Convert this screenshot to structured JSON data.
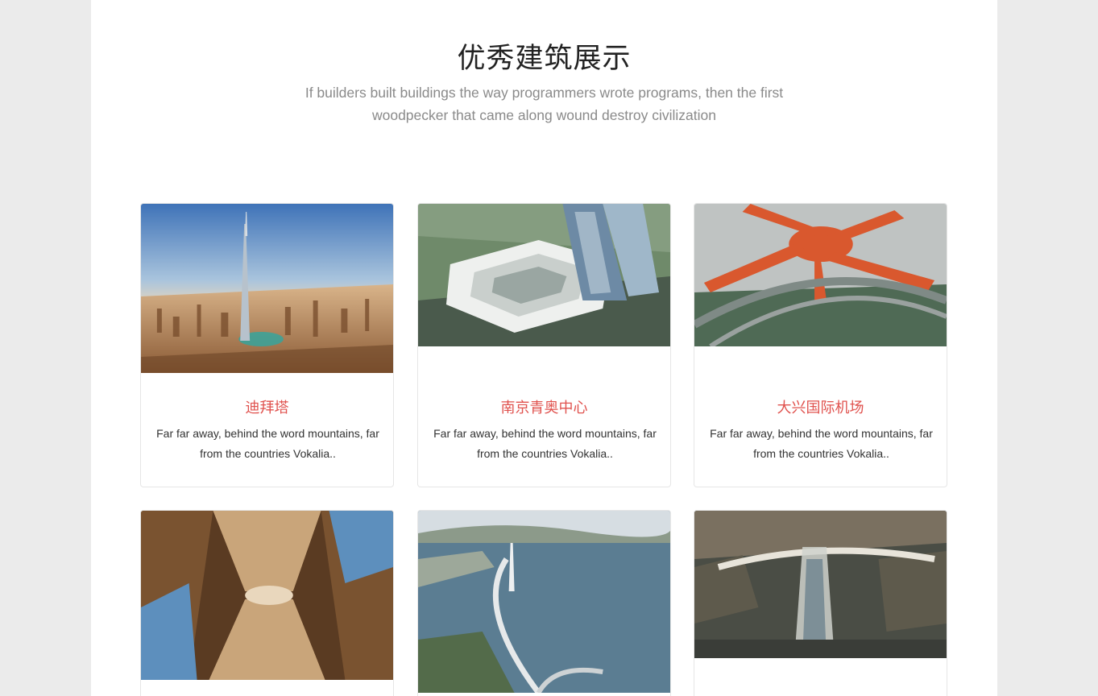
{
  "section": {
    "title": "优秀建筑展示",
    "subtitle": "If builders built buildings the way programmers wrote programs, then the first woodpecker that came along wound destroy civilization"
  },
  "cards": [
    {
      "image": "burj-khalifa-photo",
      "title": "迪拜塔",
      "description": "Far far away, behind the word mountains, far from the countries Vokalia.."
    },
    {
      "image": "nanjing-youth-olympic-center-photo",
      "title": "南京青奥中心",
      "description": "Far far away, behind the word mountains, far from the countries Vokalia.."
    },
    {
      "image": "daxing-airport-photo",
      "title": "大兴国际机场",
      "description": "Far far away, behind the word mountains, far from the countries Vokalia.."
    },
    {
      "image": "atrium-interior-photo"
    },
    {
      "image": "bridge-photo"
    },
    {
      "image": "station-aerial-photo"
    }
  ],
  "colors": {
    "accent": "#e0524e",
    "background": "#ebebeb",
    "panel": "#ffffff"
  }
}
